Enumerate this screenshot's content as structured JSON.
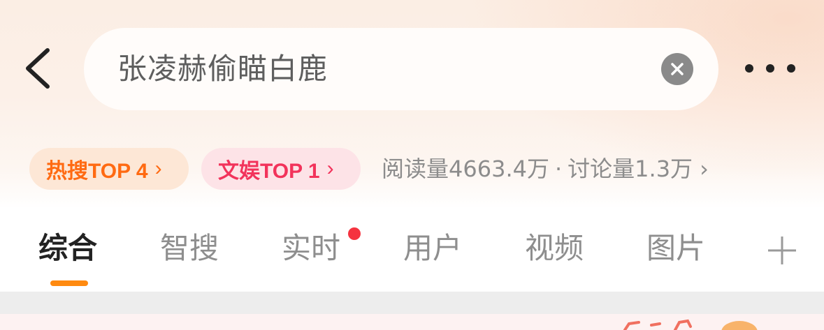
{
  "search": {
    "query": "张凌赫偷瞄白鹿"
  },
  "icons": {
    "back": "chevron-left-icon",
    "clear": "close-circle-icon",
    "more": "more-dots-icon",
    "add_tab": "plus-icon"
  },
  "badges": {
    "hot": {
      "label": "热搜TOP 4",
      "chevron": "›",
      "color": "#ff6a12"
    },
    "ent": {
      "label": "文娱TOP 1",
      "chevron": "›",
      "color": "#f2335b"
    }
  },
  "stats": {
    "reads": "阅读量4663.4万",
    "separator": "·",
    "discussions": "讨论量1.3万",
    "chevron": "›"
  },
  "tabs": [
    {
      "label": "综合",
      "active": true
    },
    {
      "label": "智搜"
    },
    {
      "label": "实时",
      "has_dot": true
    },
    {
      "label": "用户"
    },
    {
      "label": "视频"
    },
    {
      "label": "图片"
    }
  ],
  "colors": {
    "accent_orange": "#ff8a10",
    "notification_red": "#f5333f"
  }
}
